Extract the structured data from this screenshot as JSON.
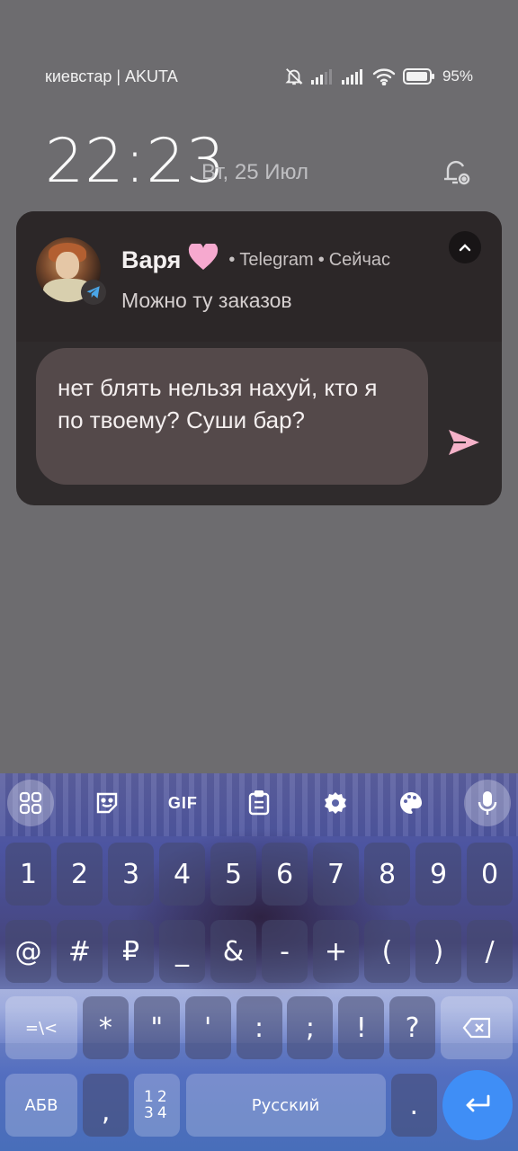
{
  "status_bar": {
    "carrier": "киевстар | AKUTA",
    "battery": "95%"
  },
  "lockscreen": {
    "time": "22:23",
    "date": "Вт, 25 Июл"
  },
  "notification": {
    "sender": "Варя",
    "app": "Telegram",
    "time": "Сейчас",
    "separator": "•",
    "message": "Можно ту заказов",
    "reply_text": "нет блять нельзя нахуй, кто я по твоему? Суши бар?"
  },
  "keyboard": {
    "row1": [
      "1",
      "2",
      "3",
      "4",
      "5",
      "6",
      "7",
      "8",
      "9",
      "0"
    ],
    "row2": [
      "@",
      "#",
      "₽",
      "_",
      "&",
      "-",
      "+",
      "(",
      ")",
      "/"
    ],
    "row3": [
      "=\\<",
      "*",
      "\"",
      "'",
      ":",
      ";",
      "!",
      "?"
    ],
    "abc_label": "АБВ",
    "comma": ",",
    "num_toggle_top": "12",
    "num_toggle_bottom": "34",
    "space_label": "Русский",
    "period": ".",
    "gif_label": "GIF"
  }
}
